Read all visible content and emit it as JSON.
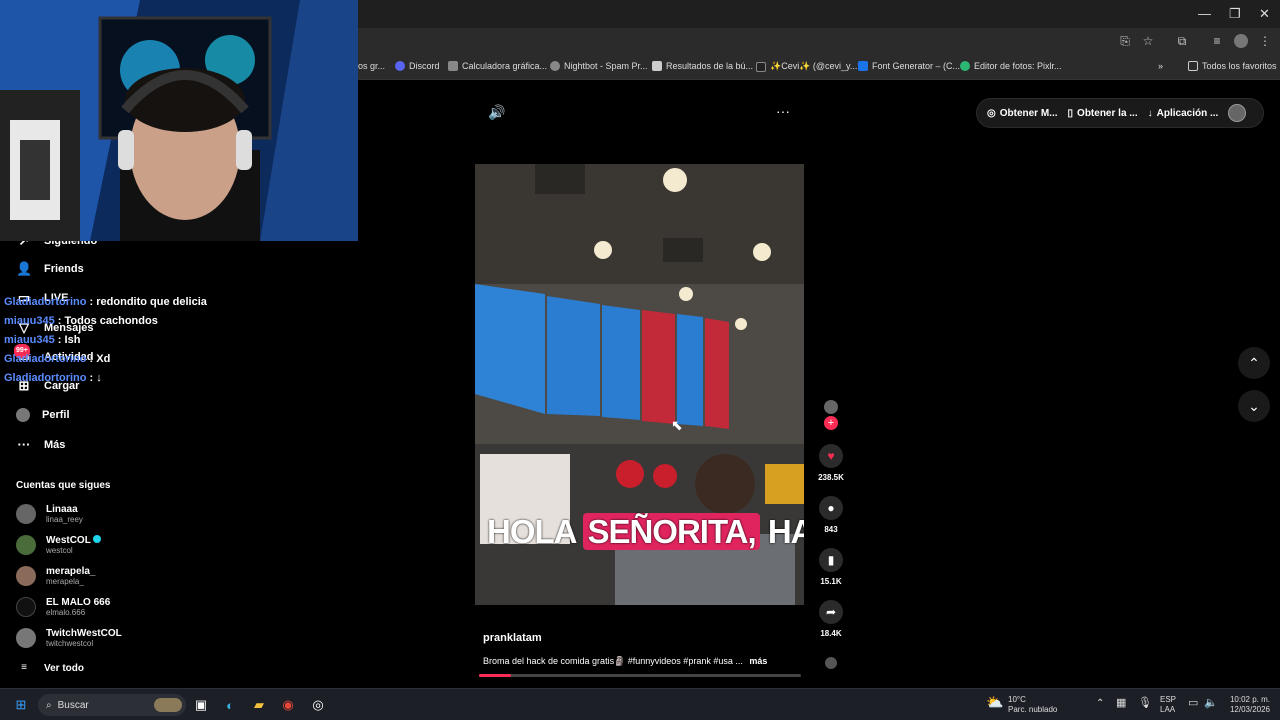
{
  "bookmarks": [
    {
      "label": "os gr...",
      "color": "#777"
    },
    {
      "label": "Discord",
      "color": "#5865f2"
    },
    {
      "label": "Calculadora gráfica...",
      "color": "#888"
    },
    {
      "label": "Nightbot - Spam Pr...",
      "color": "#888"
    },
    {
      "label": "Resultados de la bú...",
      "color": "#ccc"
    },
    {
      "label": "✨Cevi✨ (@cevi_y...",
      "color": "#222"
    },
    {
      "label": "Font Generator – (C...",
      "color": "#1a73e8"
    },
    {
      "label": "Editor de fotos: Pixlr...",
      "color": "#2bb673"
    }
  ],
  "bookmarks_all": "Todos los favoritos",
  "sidebar": {
    "following_partial": "Siguiendo",
    "items": [
      {
        "label": "Friends",
        "icon": "friends-icon",
        "glyph": "👥"
      },
      {
        "label": "LIVE",
        "icon": "live-icon",
        "glyph": "📺"
      },
      {
        "label": "Mensajes",
        "icon": "messages-icon",
        "glyph": "▽"
      },
      {
        "label": "Actividad",
        "icon": "activity-icon",
        "glyph": "✉"
      },
      {
        "label": "Cargar",
        "icon": "upload-icon",
        "glyph": "⊞"
      },
      {
        "label": "Perfil",
        "icon": "profile-icon",
        "glyph": "◉"
      },
      {
        "label": "Más",
        "icon": "more-icon",
        "glyph": "···"
      }
    ],
    "activity_badge": "99+",
    "following_title": "Cuentas que sigues",
    "accounts": [
      {
        "name": "Linaaa",
        "handle": "linaa_reey",
        "verified": false
      },
      {
        "name": "WestCOL",
        "handle": "westcol",
        "verified": true
      },
      {
        "name": "merapela_",
        "handle": "merapela_",
        "verified": false
      },
      {
        "name": "EL MALO 666",
        "handle": "elmalo.666",
        "verified": false
      },
      {
        "name": "TwitchWestCOL",
        "handle": "twitchwestcol",
        "verified": false
      }
    ],
    "see_all": "Ver todo"
  },
  "chat": [
    {
      "user": "Gladiadortorino",
      "msg": " : redondito que delicia"
    },
    {
      "user": "miauu345",
      "msg": " : Todos cachondos"
    },
    {
      "user": "miauu345",
      "msg": " : Ish"
    },
    {
      "user": "Gladiadortorino",
      "msg": " : Xd"
    },
    {
      "user": "Gladiadortorino",
      "msg": " : ↓"
    }
  ],
  "topbar": {
    "btn1": "Obtener M...",
    "btn2": "Obtener la ...",
    "btn3": "Aplicación ..."
  },
  "video": {
    "caption_plain1": "HOLA ",
    "caption_highlight": "SEÑORITA,",
    "caption_plain2": " HACE",
    "author": "pranklatam",
    "description": "Broma del hack de comida gratis🗿 #funnyvideos #prank #usa ...",
    "more": "más",
    "progress": 0.1
  },
  "stats": {
    "likes": "238.5K",
    "comments": "843",
    "saves": "15.1K",
    "shares": "18.4K"
  },
  "taskbar": {
    "search": "Buscar",
    "temp": "10°C",
    "weather": "Parc. nublado",
    "lang1": "ESP",
    "lang2": "LAA",
    "time": "10:02 p. m.",
    "date": "12/03/2026"
  }
}
